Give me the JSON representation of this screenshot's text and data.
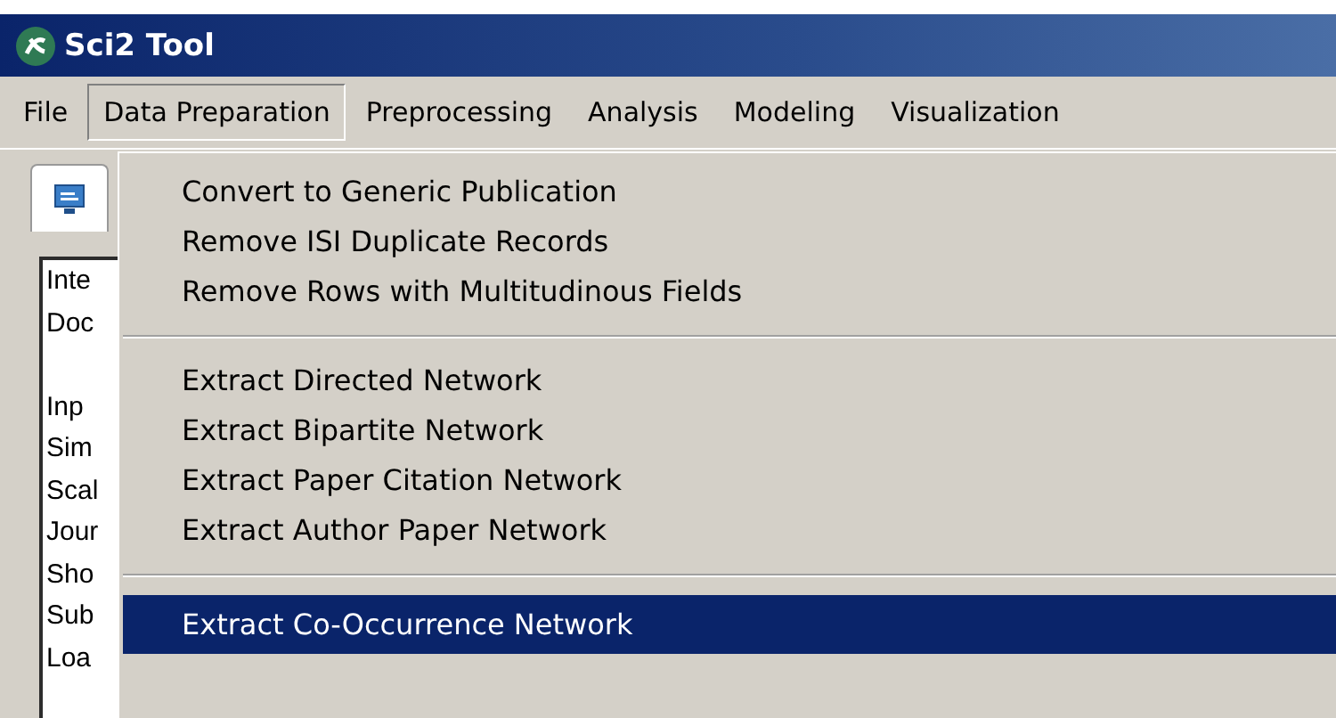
{
  "window": {
    "title": "Sci2 Tool"
  },
  "menu_bar": [
    {
      "label": "File",
      "selected": false
    },
    {
      "label": "Data Preparation",
      "selected": true
    },
    {
      "label": "Preprocessing",
      "selected": false
    },
    {
      "label": "Analysis",
      "selected": false
    },
    {
      "label": "Modeling",
      "selected": false
    },
    {
      "label": "Visualization",
      "selected": false
    }
  ],
  "console": {
    "groups": [
      [
        "Inte",
        "Doc"
      ],
      [
        "Inp",
        "Sim",
        "Scal",
        "Jour",
        "Sho",
        "Sub",
        "Loa"
      ]
    ]
  },
  "dropdown": [
    {
      "kind": "item",
      "label": "Convert to Generic Publication",
      "selected": false
    },
    {
      "kind": "item",
      "label": "Remove ISI Duplicate Records",
      "selected": false
    },
    {
      "kind": "item",
      "label": "Remove Rows with Multitudinous Fields",
      "selected": false
    },
    {
      "kind": "separator"
    },
    {
      "kind": "item",
      "label": "Extract Directed Network",
      "selected": false
    },
    {
      "kind": "item",
      "label": "Extract Bipartite Network",
      "selected": false
    },
    {
      "kind": "item",
      "label": "Extract Paper Citation Network",
      "selected": false
    },
    {
      "kind": "item",
      "label": "Extract Author Paper Network",
      "selected": false
    },
    {
      "kind": "separator"
    },
    {
      "kind": "item",
      "label": "Extract Co-Occurrence Network",
      "selected": true
    }
  ]
}
